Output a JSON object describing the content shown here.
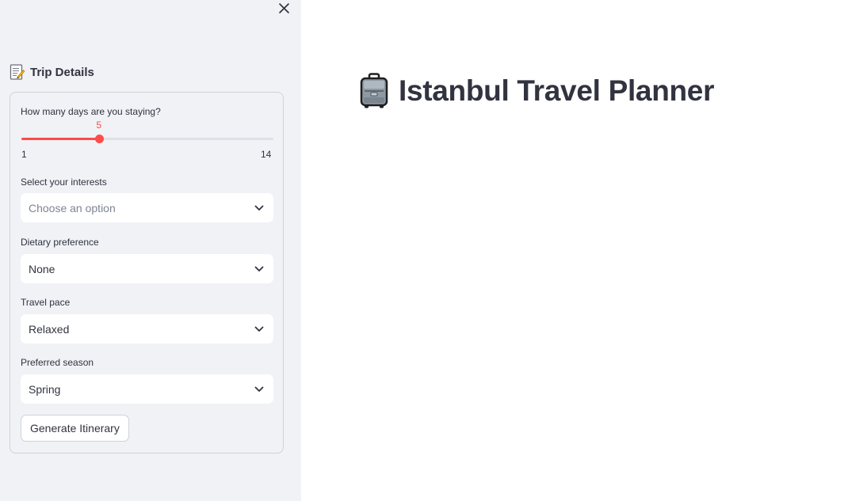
{
  "sidebar": {
    "close_icon": "close-icon",
    "header_icon": "memo-icon",
    "header": "Trip Details",
    "days": {
      "label": "How many days are you staying?",
      "value": 5,
      "value_text": "5",
      "min": 1,
      "max": 14,
      "min_text": "1",
      "max_text": "14"
    },
    "interests": {
      "label": "Select your interests",
      "placeholder": "Choose an option"
    },
    "dietary": {
      "label": "Dietary preference",
      "value": "None"
    },
    "pace": {
      "label": "Travel pace",
      "value": "Relaxed"
    },
    "season": {
      "label": "Preferred season",
      "value": "Spring"
    },
    "generate_label": "Generate Itinerary"
  },
  "main": {
    "title_icon": "luggage-icon",
    "title": "Istanbul Travel Planner"
  },
  "colors": {
    "accent": "#ff4b4b",
    "sidebar_bg": "#f0f2f6",
    "text": "#31333f"
  }
}
